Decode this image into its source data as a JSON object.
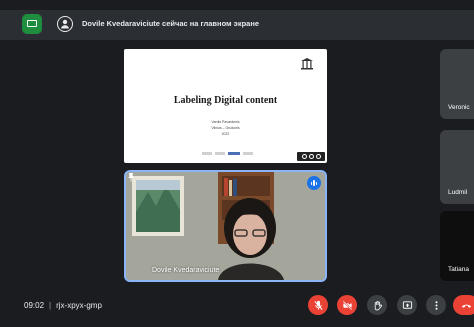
{
  "banner": {
    "text": "Dovile Kvedaraviciute сейчас на главном экране",
    "app_icon": "meet-badge-icon",
    "presentation_icon": "presenting-user-icon"
  },
  "slide": {
    "title": "Labeling Digital content",
    "subtitle_lines": [
      "Vardis Pavardenis",
      "Vilnius – Grudonis",
      "2022"
    ],
    "badge": "cc-license-icon"
  },
  "camera": {
    "participant_name": "Dovile Kvedaraviciute",
    "speaking_icon": "audio-level-icon",
    "pin_icon": "pin-icon"
  },
  "participants": [
    {
      "name": "Veronic"
    },
    {
      "name": "Ludmil"
    },
    {
      "name": "Tatiana"
    }
  ],
  "meeting": {
    "time": "09:02",
    "code": "rjx-xpyx-gmp"
  },
  "controls": [
    {
      "name": "mic-off-icon"
    },
    {
      "name": "camera-off-icon"
    },
    {
      "name": "raise-hand-icon"
    },
    {
      "name": "present-now-icon"
    },
    {
      "name": "more-options-icon"
    },
    {
      "name": "end-call-icon"
    }
  ],
  "colors": {
    "background": "#1a1c20",
    "accent_blue": "#1a73e8",
    "danger_red": "#ea4335",
    "control_gray": "#3c4043"
  }
}
